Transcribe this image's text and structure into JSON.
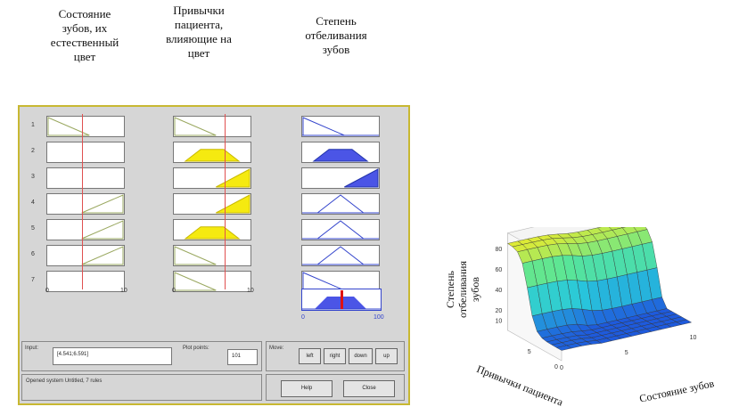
{
  "columns": {
    "input1_title": [
      "Состояние",
      "зубов, их",
      "естественный",
      "цвет"
    ],
    "input2_title": [
      "Привычки",
      "пациента,",
      "влияющие на",
      "цвет"
    ],
    "output_title": [
      "Степень",
      "отбеливания",
      "зубов"
    ]
  },
  "rules": [
    "1",
    "2",
    "3",
    "4",
    "5",
    "6",
    "7"
  ],
  "axis_ticks": {
    "input1": [
      "0",
      "10"
    ],
    "input2": [
      "0",
      "10"
    ],
    "output": [
      "0",
      "100"
    ]
  },
  "controls": {
    "input_label": "Input:",
    "input_value": "[4.541;6.591]",
    "plot_points_label": "Plot points:",
    "plot_points_value": "101",
    "move_label": "Move:",
    "move_buttons": [
      "left",
      "right",
      "down",
      "up"
    ],
    "status_text": "Opened system Untitled, 7 rules",
    "help_label": "Help",
    "close_label": "Close"
  },
  "surface": {
    "zlabel": [
      "Степень",
      "отбеливания",
      "зубов"
    ],
    "ylabel": "Привычки пациента",
    "xlabel": "Состояние зубов",
    "z_ticks": [
      "80",
      "60",
      "40",
      "20",
      "10"
    ],
    "x_ticks": [
      "0",
      "5",
      "10"
    ],
    "y_ticks": [
      "0",
      "5"
    ]
  },
  "colors": {
    "panel_bg": "#d6d6d6",
    "panel_border": "#c8b832",
    "input_mf_fill": "#f5ea10",
    "output_mf_fill": "#4b55e6",
    "indicator_line": "#e05050",
    "output_bar": "#e01010"
  }
}
